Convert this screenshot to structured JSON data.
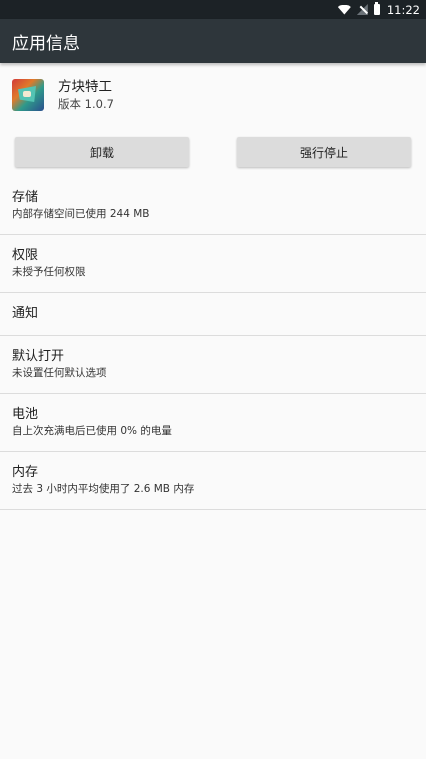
{
  "status_bar": {
    "time": "11:22",
    "icons": [
      "wifi-icon",
      "signal-icon",
      "battery-icon"
    ]
  },
  "app_bar": {
    "title": "应用信息"
  },
  "app": {
    "name": "方块特工",
    "version": "版本 1.0.7"
  },
  "buttons": {
    "uninstall": "卸载",
    "force_stop": "强行停止"
  },
  "settings": [
    {
      "title": "存储",
      "subtitle": "内部存储空间已使用 244 MB"
    },
    {
      "title": "权限",
      "subtitle": "未授予任何权限"
    },
    {
      "title": "通知",
      "subtitle": ""
    },
    {
      "title": "默认打开",
      "subtitle": "未设置任何默认选项"
    },
    {
      "title": "电池",
      "subtitle": "自上次充满电后已使用 0% 的电量"
    },
    {
      "title": "内存",
      "subtitle": "过去 3 小时内平均使用了 2.6 MB 内存"
    }
  ],
  "colors": {
    "status_bar": "#1c2226",
    "app_bar": "#2e363b",
    "background": "#fafafa",
    "button": "#dcdcdc"
  }
}
